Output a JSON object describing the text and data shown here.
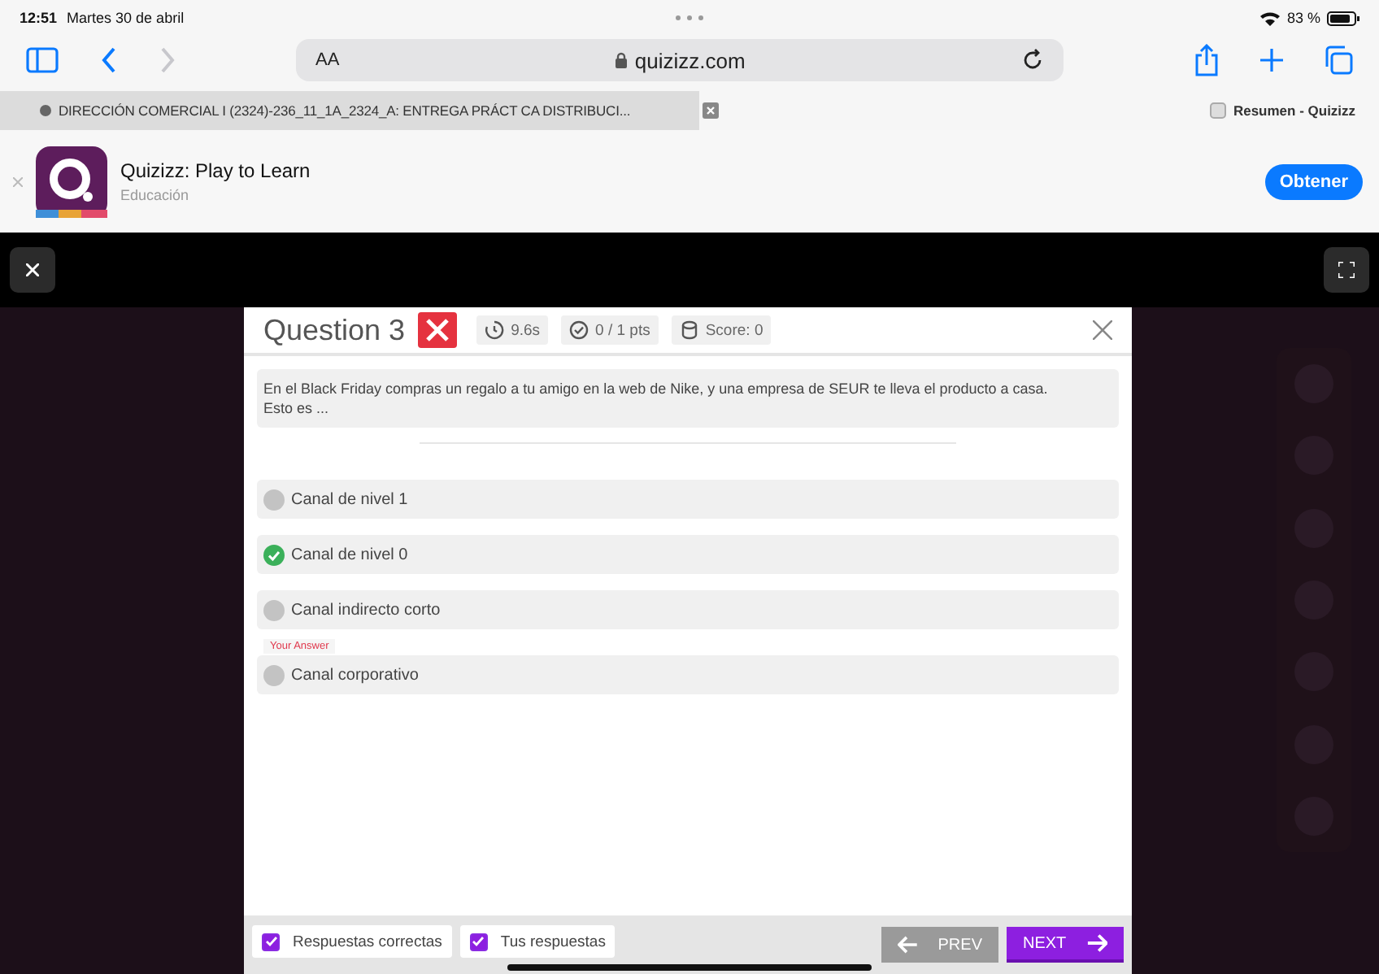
{
  "status_bar": {
    "time": "12:51",
    "date": "Martes 30 de abril",
    "battery": "83 %"
  },
  "toolbar": {
    "text_size": "AA",
    "url": "quizizz.com",
    "forward_disabled": true
  },
  "tabs": [
    {
      "title": "DIRECCIÓN COMERCIAL I (2324)-236_11_1A_2324_A: ENTREGA PRÁCT CA DISTRIBUCI...",
      "selected": false
    },
    {
      "title": "Resumen - Quizizz",
      "selected": true
    }
  ],
  "app_banner": {
    "name": "Quizizz: Play to Learn",
    "category": "Educación",
    "button": "Obtener"
  },
  "question": {
    "title": "Question 3",
    "correct": false,
    "time": "9.6s",
    "points": "0 / 1 pts",
    "score": "Score: 0",
    "text": "En el Black Friday compras un regalo a tu amigo en la web de Nike, y una empresa de SEUR te lleva el producto a casa. Esto es ..."
  },
  "options": [
    {
      "text": "Canal de nivel 1",
      "kind": "plain",
      "your_answer": false
    },
    {
      "text": "Canal de nivel 0",
      "kind": "correct",
      "your_answer": false
    },
    {
      "text": "Canal indirecto corto",
      "kind": "plain",
      "your_answer": false
    },
    {
      "text": "Canal corporativo",
      "kind": "plain",
      "your_answer": true,
      "tag": "Your Answer"
    }
  ],
  "footer": {
    "filters": [
      {
        "label": "Respuestas correctas",
        "checked": true
      },
      {
        "label": "Tus respuestas",
        "checked": true
      }
    ],
    "prev": {
      "label": "PREV",
      "disabled": true
    },
    "next": {
      "label": "NEXT",
      "disabled": false
    }
  }
}
